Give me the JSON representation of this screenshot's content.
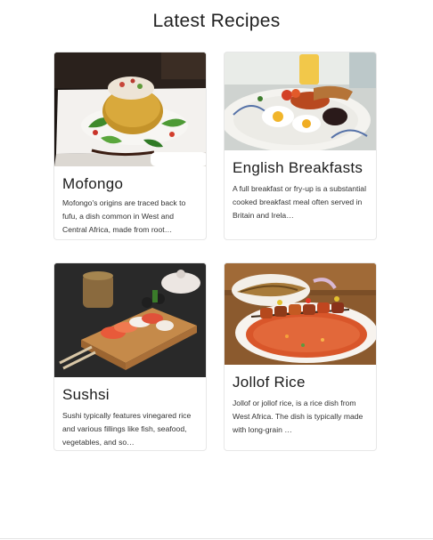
{
  "page": {
    "title": "Latest Recipes"
  },
  "recipes": [
    {
      "name": "Mofongo",
      "description": "Mofongo's origins are traced back to fufu, a dish common in West and Central Africa, made from root…"
    },
    {
      "name": "English Breakfasts",
      "description": "A full breakfast or fry-up is a substantial cooked breakfast meal often served in Britain and Irela…"
    },
    {
      "name": "Sushsi",
      "description": "Sushi typically features vinegared rice and various fillings like fish, seafood, vegetables, and so…"
    },
    {
      "name": "Jollof Rice",
      "description": "Jollof or jollof rice, is a rice dish from West Africa. The dish is typically made with long-grain …"
    }
  ]
}
